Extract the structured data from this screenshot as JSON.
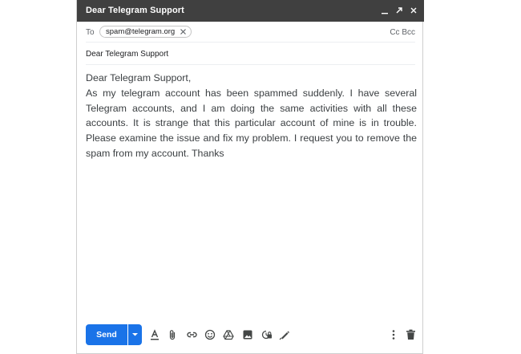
{
  "window": {
    "title": "Dear Telegram Support",
    "controls": [
      "minimize-icon",
      "expand-icon",
      "close-icon"
    ]
  },
  "recipients": {
    "to_label": "To",
    "chips": [
      {
        "email": "spam@telegram.org"
      }
    ],
    "cc_label": "Cc",
    "bcc_label": "Bcc"
  },
  "subject": "Dear Telegram Support",
  "message": {
    "greeting": "Dear Telegram Support,",
    "text": "As my telegram account has been spammed suddenly. I have several Telegram accounts, and I am doing the same activities with all these accounts. It is strange that this particular account of mine is in trouble. Please examine the issue and fix my problem. I request you to remove the spam from my account. Thanks"
  },
  "toolbar": {
    "send_label": "Send",
    "tools": [
      "formatting-icon",
      "attach-icon",
      "link-icon",
      "emoji-icon",
      "drive-icon",
      "photo-icon",
      "confidential-icon",
      "signature-icon",
      "more-options-icon",
      "trash-icon"
    ]
  },
  "colors": {
    "titlebar": "#404040",
    "send": "#1a73e8"
  }
}
